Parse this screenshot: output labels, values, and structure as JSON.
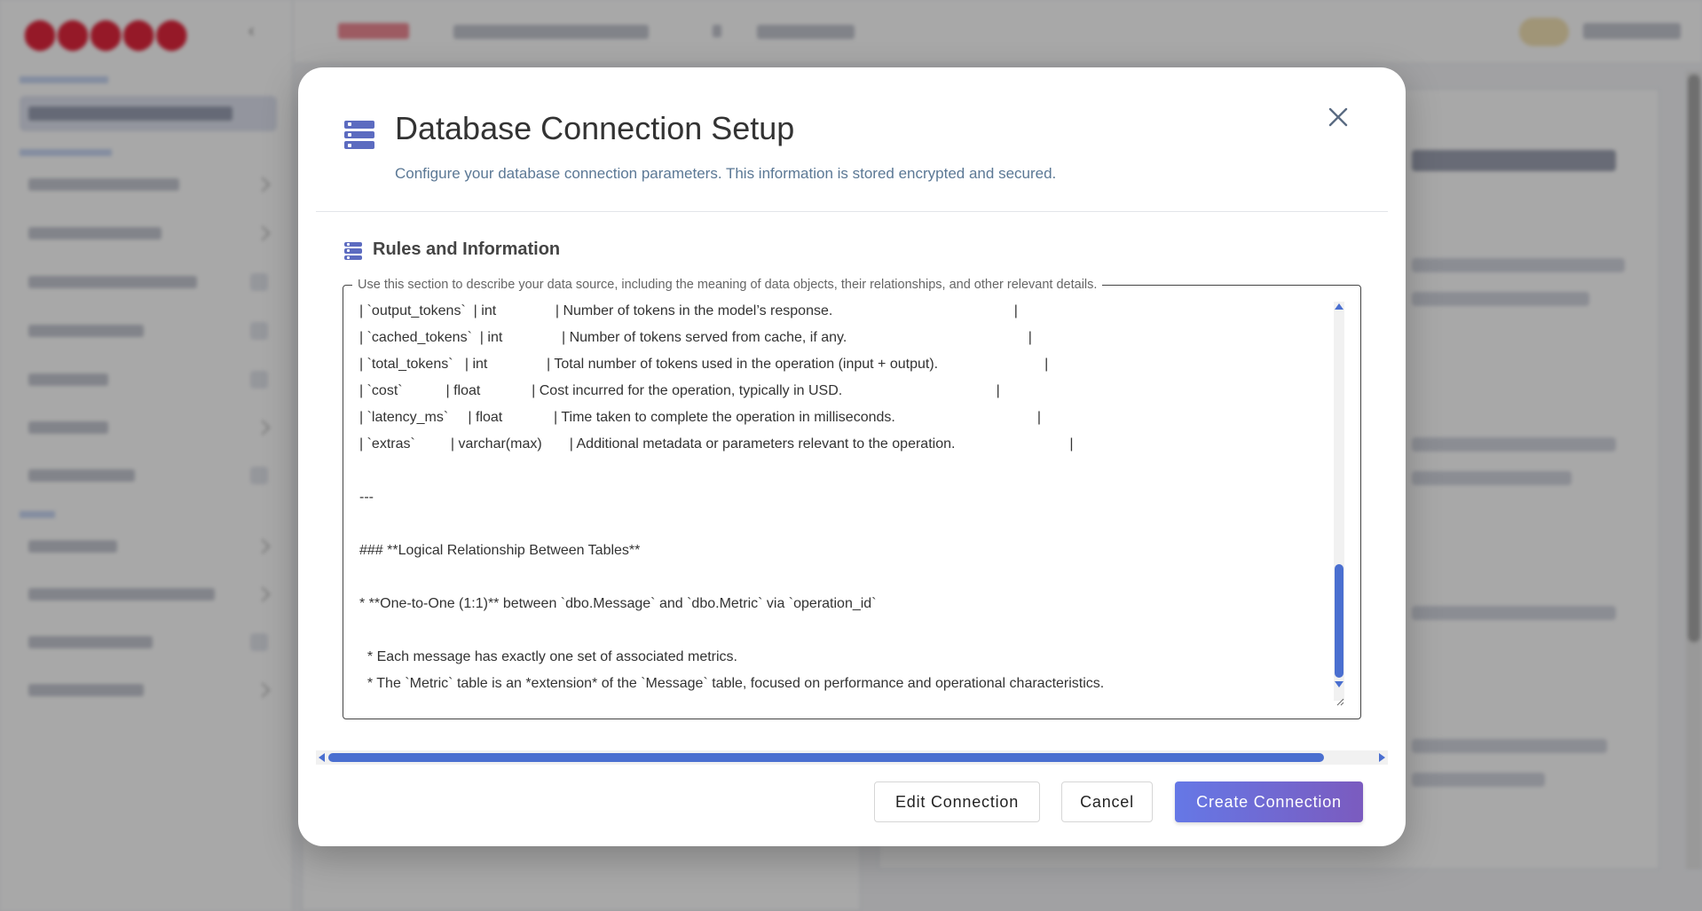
{
  "modal": {
    "title": "Database Connection Setup",
    "subtitle": "Configure your database connection parameters. This information is stored encrypted and secured.",
    "section_title": "Rules and Information",
    "field_legend": "Use this section to describe your data source, including the meaning of data objects, their relationships, and other relevant details.",
    "textarea_lines": [
      "| `output_tokens`  | int               | Number of tokens in the model’s response.                                              |",
      "| `cached_tokens`  | int               | Number of tokens served from cache, if any.                                              |",
      "| `total_tokens`   | int               | Total number of tokens used in the operation (input + output).                           |",
      "| `cost`           | float             | Cost incurred for the operation, typically in USD.                                       |",
      "| `latency_ms`     | float             | Time taken to complete the operation in milliseconds.                                    |",
      "| `extras`         | varchar(max)       | Additional metadata or parameters relevant to the operation.                             |",
      "",
      "---",
      "",
      "### **Logical Relationship Between Tables**",
      "",
      "* **One-to-One (1:1)** between `dbo.Message` and `dbo.Metric` via `operation_id`",
      "",
      "  * Each message has exactly one set of associated metrics.",
      "  * The `Metric` table is an *extension* of the `Message` table, focused on performance and operational characteristics."
    ],
    "buttons": {
      "edit": "Edit Connection",
      "cancel": "Cancel",
      "create": "Create Connection"
    }
  },
  "colors": {
    "accent": "#5c6bc0",
    "primary_gradient_start": "#6578e6",
    "primary_gradient_end": "#7b5bbf",
    "scrollbar": "#4a6fd0",
    "brand": "#e3263d"
  },
  "icons": {
    "modal": "database-icon",
    "section": "database-icon",
    "close": "close-icon"
  }
}
